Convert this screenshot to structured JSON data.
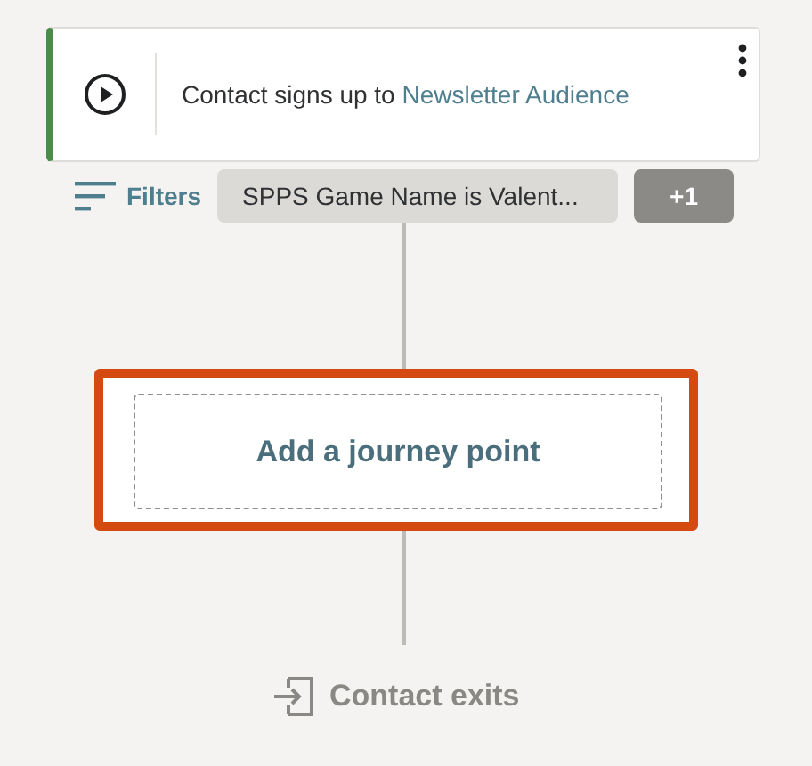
{
  "trigger": {
    "text": "Contact signs up to ",
    "link": "Newsletter Audience",
    "active": true
  },
  "filters": {
    "label": "Filters",
    "chips": [
      {
        "kind": "condition",
        "text": "SPPS Game Name is Valent..."
      },
      {
        "kind": "more",
        "text": "+1"
      }
    ]
  },
  "add_point": {
    "label": "Add a journey point",
    "highlighted": true
  },
  "exit": {
    "label": "Contact exits"
  }
}
